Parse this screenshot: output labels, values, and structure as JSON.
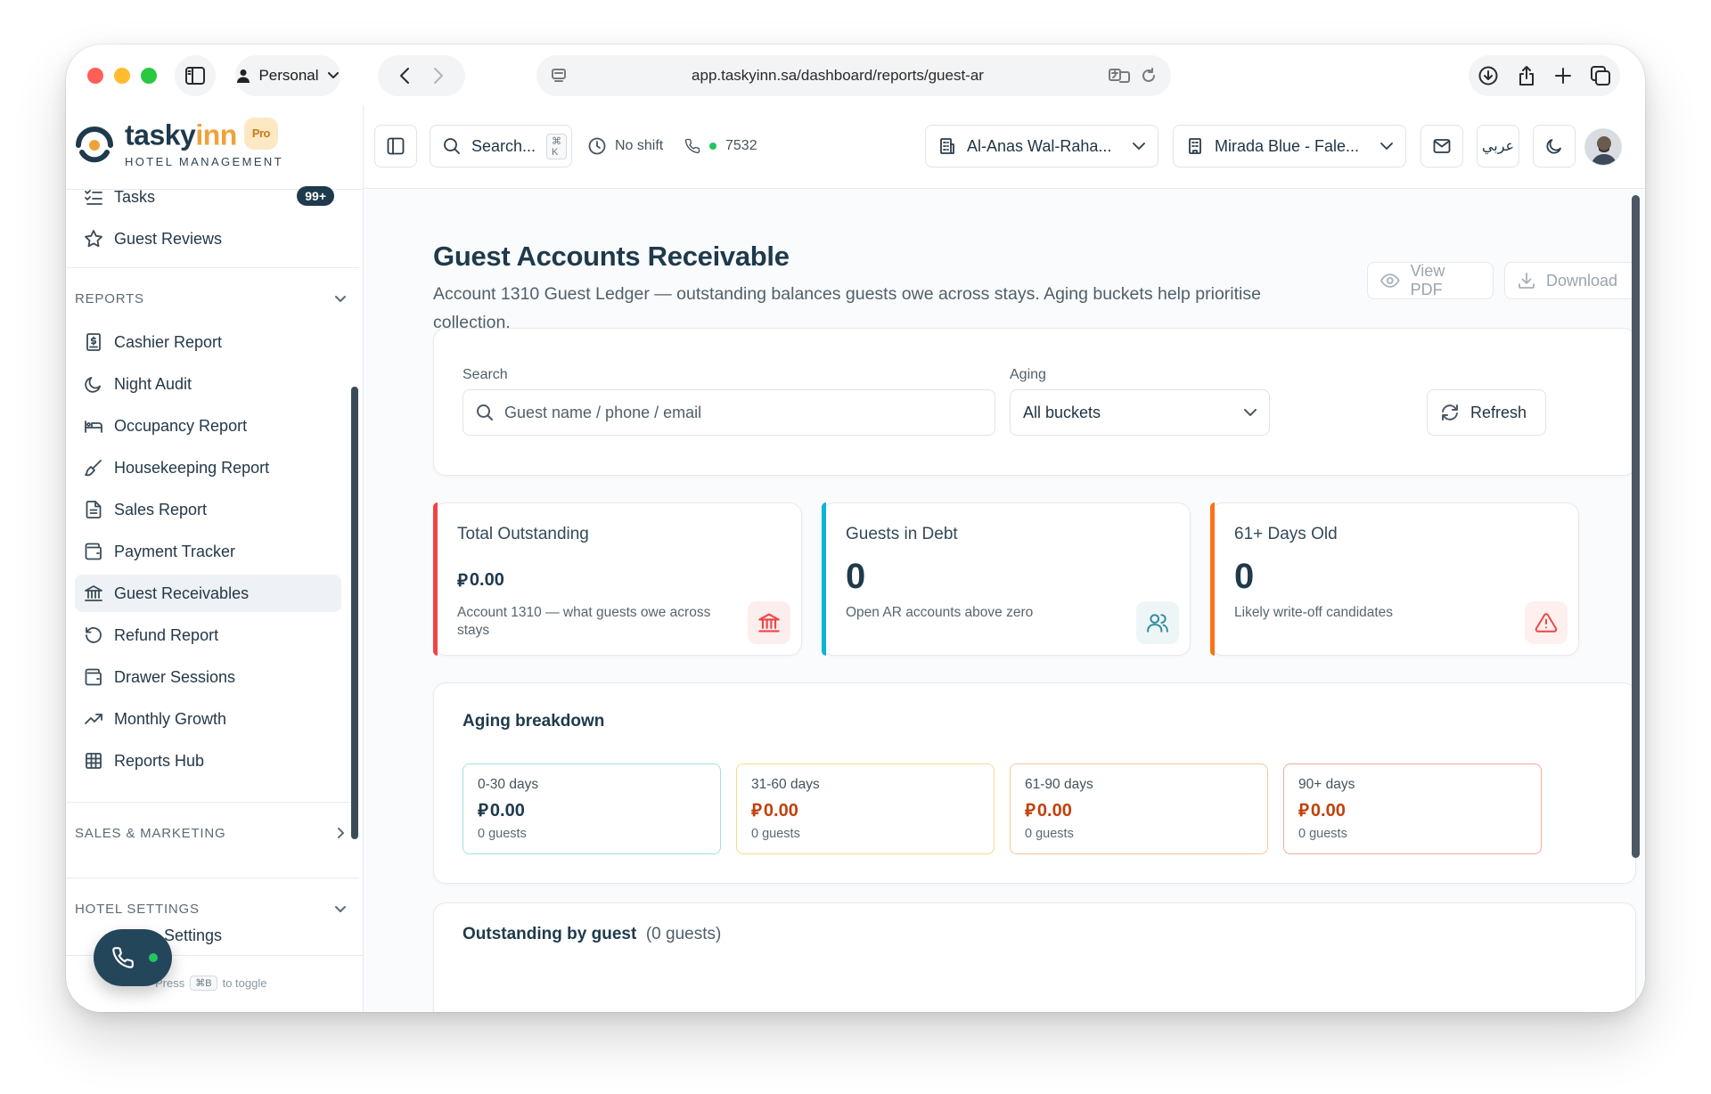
{
  "browser": {
    "profile": "Personal",
    "url": "app.taskyinn.sa/dashboard/reports/guest-ar"
  },
  "brand": {
    "name_main": "tasky",
    "name_accent": "inn",
    "tier": "Pro",
    "tagline": "HOTEL MANAGEMENT"
  },
  "sidebar": {
    "tasks": {
      "label": "Tasks",
      "badge": "99+"
    },
    "guest_reviews": "Guest Reviews",
    "reports_header": "REPORTS",
    "reports": [
      {
        "label": "Cashier Report",
        "icon": "receipt-icon"
      },
      {
        "label": "Night Audit",
        "icon": "moon-icon"
      },
      {
        "label": "Occupancy Report",
        "icon": "bed-icon"
      },
      {
        "label": "Housekeeping Report",
        "icon": "brush-icon"
      },
      {
        "label": "Sales Report",
        "icon": "file-text-icon"
      },
      {
        "label": "Payment Tracker",
        "icon": "wallet-icon"
      },
      {
        "label": "Guest Receivables",
        "icon": "bank-icon",
        "active": true
      },
      {
        "label": "Refund Report",
        "icon": "undo-icon"
      },
      {
        "label": "Drawer Sessions",
        "icon": "wallet-icon"
      },
      {
        "label": "Monthly Growth",
        "icon": "trending-up-icon"
      },
      {
        "label": "Reports Hub",
        "icon": "grid-icon"
      }
    ],
    "sales_marketing_header": "SALES & MARKETING",
    "hotel_settings_header": "HOTEL SETTINGS",
    "peek_item": "Settings",
    "toggle_hint_prefix": "Press",
    "toggle_hint_key": "⌘B",
    "toggle_hint_suffix": "to toggle"
  },
  "topbar": {
    "search_label": "Search...",
    "search_shortcut": "⌘ K",
    "shift_status": "No shift",
    "extension": "7532",
    "property_1": "Al-Anas Wal-Raha...",
    "property_2": "Mirada Blue - Fale...",
    "language": "عربي"
  },
  "page": {
    "title": "Guest Accounts Receivable",
    "subtitle": "Account 1310 Guest Ledger — outstanding balances guests owe across stays. Aging buckets help prioritise collection.",
    "view_pdf": "View PDF",
    "download": "Download"
  },
  "filters": {
    "search_label": "Search",
    "search_placeholder": "Guest name / phone / email",
    "aging_label": "Aging",
    "aging_value": "All buckets",
    "refresh": "Refresh"
  },
  "stats": [
    {
      "title": "Total Outstanding",
      "value": "0.00",
      "currency": true,
      "desc": "Account 1310 — what guests owe across stays",
      "accent": "#ef4444",
      "icon": "bank-icon",
      "icon_color": "#ef4444",
      "icon_bg": "#fdeeee"
    },
    {
      "title": "Guests in Debt",
      "value": "0",
      "currency": false,
      "desc": "Open AR accounts above zero",
      "accent": "#06b6d4",
      "icon": "users-icon",
      "icon_color": "#2a8c9c",
      "icon_bg": "#eef5f6"
    },
    {
      "title": "61+ Days Old",
      "value": "0",
      "currency": false,
      "desc": "Likely write-off candidates",
      "accent": "#f97316",
      "icon": "alert-triangle-icon",
      "icon_color": "#ef4444",
      "icon_bg": "#fdf0ee"
    }
  ],
  "aging": {
    "title": "Aging breakdown",
    "buckets": [
      {
        "label": "0-30 days",
        "amount": "0.00",
        "count": "0 guests",
        "border": "#99e6dc",
        "color": "#1e3a4c"
      },
      {
        "label": "31-60 days",
        "amount": "0.00",
        "count": "0 guests",
        "border": "#f7d98b",
        "color": "#c2410c"
      },
      {
        "label": "61-90 days",
        "amount": "0.00",
        "count": "0 guests",
        "border": "#f9c49a",
        "color": "#c2410c"
      },
      {
        "label": "90+ days",
        "amount": "0.00",
        "count": "0 guests",
        "border": "#f4a99a",
        "color": "#c2410c"
      }
    ]
  },
  "outstanding": {
    "title": "Outstanding by guest",
    "count": "(0 guests)"
  },
  "colors": {
    "brand_navy": "#1e3a4c",
    "brand_orange": "#f0a23a",
    "traffic_red": "#ff5f57",
    "traffic_yellow": "#febc2e",
    "traffic_green": "#28c840"
  }
}
